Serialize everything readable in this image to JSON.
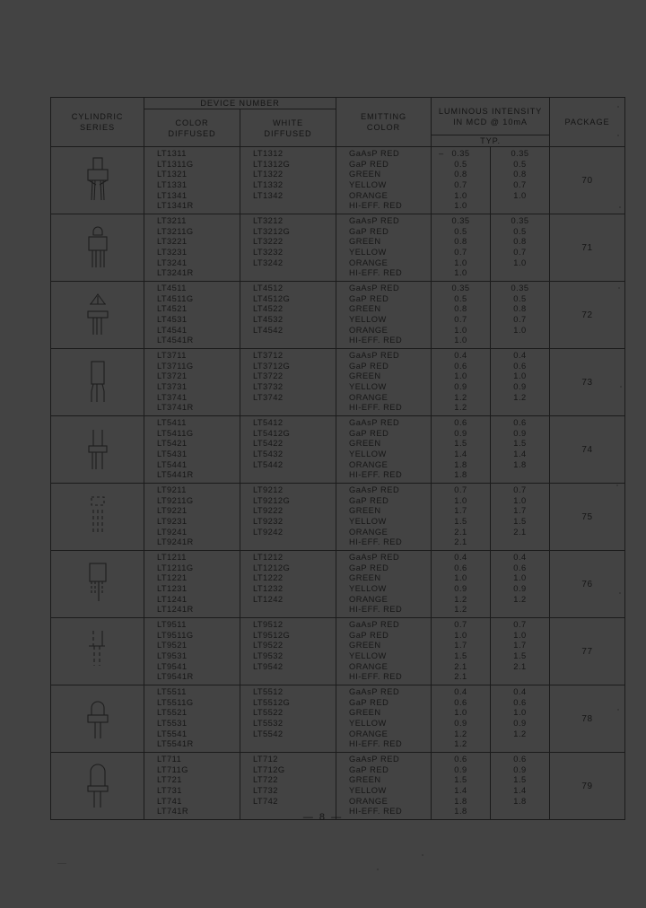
{
  "document": {
    "page_number": "— 8 —",
    "paper_color": "#434343",
    "ink_color": "#161616"
  },
  "table": {
    "headers": {
      "series": {
        "line1": "CYLINDRIC",
        "line2": "SERIES"
      },
      "device_number": "DEVICE  NUMBER",
      "color_diffused": {
        "line1": "COLOR",
        "line2": "DIFFUSED"
      },
      "white_diffused": {
        "line1": "WHITE",
        "line2": "DIFFUSED"
      },
      "emitting_color": {
        "line1": "EMITTING",
        "line2": "COLOR"
      },
      "luminous": {
        "line1": "LUMINOUS INTENSITY",
        "line2": "IN MCD @ 10mA"
      },
      "typ": "TYP.",
      "package": "PACKAGE"
    },
    "blocks": [
      {
        "package": "70",
        "art": "led-t1-flat",
        "color_diffused": [
          "LT1311",
          "LT1311G",
          "LT1321",
          "LT1331",
          "LT1341",
          "LT1341R"
        ],
        "white_diffused": [
          "LT1312",
          "LT1312G",
          "LT1322",
          "LT1332",
          "LT1342",
          ""
        ],
        "emitting_color": [
          "GaAsP RED",
          "GaP RED",
          "GREEN",
          "YELLOW",
          "ORANGE",
          "HI-EFF. RED"
        ],
        "typ_a": [
          "0.35",
          "0.5",
          "0.8",
          "0.7",
          "1.0",
          "1.0"
        ],
        "typ_b": [
          "0.35",
          "0.5",
          "0.8",
          "0.7",
          "1.0",
          ""
        ],
        "lead_dash": "–"
      },
      {
        "package": "71",
        "art": "led-t1-dome",
        "color_diffused": [
          "LT3211",
          "LT3211G",
          "LT3221",
          "LT3231",
          "LT3241",
          "LT3241R"
        ],
        "white_diffused": [
          "LT3212",
          "LT3212G",
          "LT3222",
          "LT3232",
          "LT3242",
          ""
        ],
        "emitting_color": [
          "GaAsP RED",
          "GaP RED",
          "GREEN",
          "YELLOW",
          "ORANGE",
          "HI-EFF. RED"
        ],
        "typ_a": [
          "0.35",
          "0.5",
          "0.8",
          "0.7",
          "1.0",
          "1.0"
        ],
        "typ_b": [
          "0.35",
          "0.5",
          "0.8",
          "0.7",
          "1.0",
          ""
        ],
        "lead_dash": ""
      },
      {
        "package": "72",
        "art": "led-t1-tri",
        "color_diffused": [
          "LT4511",
          "LT4511G",
          "LT4521",
          "LT4531",
          "LT4541",
          "LT4541R"
        ],
        "white_diffused": [
          "LT4512",
          "LT4512G",
          "LT4522",
          "LT4532",
          "LT4542",
          ""
        ],
        "emitting_color": [
          "GaAsP RED",
          "GaP RED",
          "GREEN",
          "YELLOW",
          "ORANGE",
          "HI-EFF. RED"
        ],
        "typ_a": [
          "0.35",
          "0.5",
          "0.8",
          "0.7",
          "1.0",
          "1.0"
        ],
        "typ_b": [
          "0.35",
          "0.5",
          "0.8",
          "0.7",
          "1.0",
          ""
        ],
        "lead_dash": ""
      },
      {
        "package": "73",
        "art": "led-rect-tall",
        "color_diffused": [
          "LT3711",
          "LT3711G",
          "LT3721",
          "LT3731",
          "LT3741",
          "LT3741R"
        ],
        "white_diffused": [
          "LT3712",
          "LT3712G",
          "LT3722",
          "LT3732",
          "LT3742",
          ""
        ],
        "emitting_color": [
          "GaAsP RED",
          "GaP RED",
          "GREEN",
          "YELLOW",
          "ORANGE",
          "HI-EFF. RED"
        ],
        "typ_a": [
          "0.4",
          "0.6",
          "1.0",
          "0.9",
          "1.2",
          "1.2"
        ],
        "typ_b": [
          "0.4",
          "0.6",
          "1.0",
          "0.9",
          "1.2",
          ""
        ],
        "lead_dash": ""
      },
      {
        "package": "74",
        "art": "led-flange",
        "color_diffused": [
          "LT5411",
          "LT5411G",
          "LT5421",
          "LT5431",
          "LT5441",
          "LT5441R"
        ],
        "white_diffused": [
          "LT5412",
          "LT5412G",
          "LT5422",
          "LT5432",
          "LT5442",
          ""
        ],
        "emitting_color": [
          "GaAsP RED",
          "GaP RED",
          "GREEN",
          "YELLOW",
          "ORANGE",
          "HI-EFF. RED"
        ],
        "typ_a": [
          "0.6",
          "0.9",
          "1.5",
          "1.4",
          "1.8",
          "1.8"
        ],
        "typ_b": [
          "0.6",
          "0.9",
          "1.5",
          "1.4",
          "1.8",
          ""
        ],
        "lead_dash": ""
      },
      {
        "package": "75",
        "art": "led-dashed",
        "color_diffused": [
          "LT9211",
          "LT9211G",
          "LT9221",
          "LT9231",
          "LT9241",
          "LT9241R"
        ],
        "white_diffused": [
          "LT9212",
          "LT9212G",
          "LT9222",
          "LT9232",
          "LT9242",
          ""
        ],
        "emitting_color": [
          "GaAsP RED",
          "GaP RED",
          "GREEN",
          "YELLOW",
          "ORANGE",
          "HI-EFF. RED"
        ],
        "typ_a": [
          "0.7",
          "1.0",
          "1.7",
          "1.5",
          "2.1",
          "2.1"
        ],
        "typ_b": [
          "0.7",
          "1.0",
          "1.7",
          "1.5",
          "2.1",
          ""
        ],
        "lead_dash": ""
      },
      {
        "package": "76",
        "art": "led-box-leads",
        "color_diffused": [
          "LT1211",
          "LT1211G",
          "LT1221",
          "LT1231",
          "LT1241",
          "LT1241R"
        ],
        "white_diffused": [
          "LT1212",
          "LT1212G",
          "LT1222",
          "LT1232",
          "LT1242",
          ""
        ],
        "emitting_color": [
          "GaAsP RED",
          "GaP RED",
          "GREEN",
          "YELLOW",
          "ORANGE",
          "HI-EFF. RED"
        ],
        "typ_a": [
          "0.4",
          "0.6",
          "1.0",
          "0.9",
          "1.2",
          "1.2"
        ],
        "typ_b": [
          "0.4",
          "0.6",
          "1.0",
          "0.9",
          "1.2",
          ""
        ],
        "lead_dash": ""
      },
      {
        "package": "77",
        "art": "led-thin-tall",
        "color_diffused": [
          "LT9511",
          "LT9511G",
          "LT9521",
          "LT9531",
          "LT9541",
          "LT9541R"
        ],
        "white_diffused": [
          "LT9512",
          "LT9512G",
          "LT9522",
          "LT9532",
          "LT9542",
          ""
        ],
        "emitting_color": [
          "GaAsP RED",
          "GaP RED",
          "GREEN",
          "YELLOW",
          "ORANGE",
          "HI-EFF. RED"
        ],
        "typ_a": [
          "0.7",
          "1.0",
          "1.7",
          "1.5",
          "2.1",
          "2.1"
        ],
        "typ_b": [
          "0.7",
          "1.0",
          "1.7",
          "1.5",
          "2.1",
          ""
        ],
        "lead_dash": ""
      },
      {
        "package": "78",
        "art": "led-dome-flange",
        "color_diffused": [
          "LT5511",
          "LT5511G",
          "LT5521",
          "LT5531",
          "LT5541",
          "LT5541R"
        ],
        "white_diffused": [
          "LT5512",
          "LT5512G",
          "LT5522",
          "LT5532",
          "LT5542",
          ""
        ],
        "emitting_color": [
          "GaAsP RED",
          "GaP RED",
          "GREEN",
          "YELLOW",
          "ORANGE",
          "HI-EFF. RED"
        ],
        "typ_a": [
          "0.4",
          "0.6",
          "1.0",
          "0.9",
          "1.2",
          "1.2"
        ],
        "typ_b": [
          "0.4",
          "0.6",
          "1.0",
          "0.9",
          "1.2",
          ""
        ],
        "lead_dash": ""
      },
      {
        "package": "79",
        "art": "led-cyl-large",
        "color_diffused": [
          "LT711",
          "LT711G",
          "LT721",
          "LT731",
          "LT741",
          "LT741R"
        ],
        "white_diffused": [
          "LT712",
          "LT712G",
          "LT722",
          "LT732",
          "LT742",
          ""
        ],
        "emitting_color": [
          "GaAsP RED",
          "GaP RED",
          "GREEN",
          "YELLOW",
          "ORANGE",
          "HI-EFF. RED"
        ],
        "typ_a": [
          "0.6",
          "0.9",
          "1.5",
          "1.4",
          "1.8",
          "1.8"
        ],
        "typ_b": [
          "0.6",
          "0.9",
          "1.5",
          "1.4",
          "1.8",
          ""
        ],
        "lead_dash": ""
      }
    ]
  }
}
